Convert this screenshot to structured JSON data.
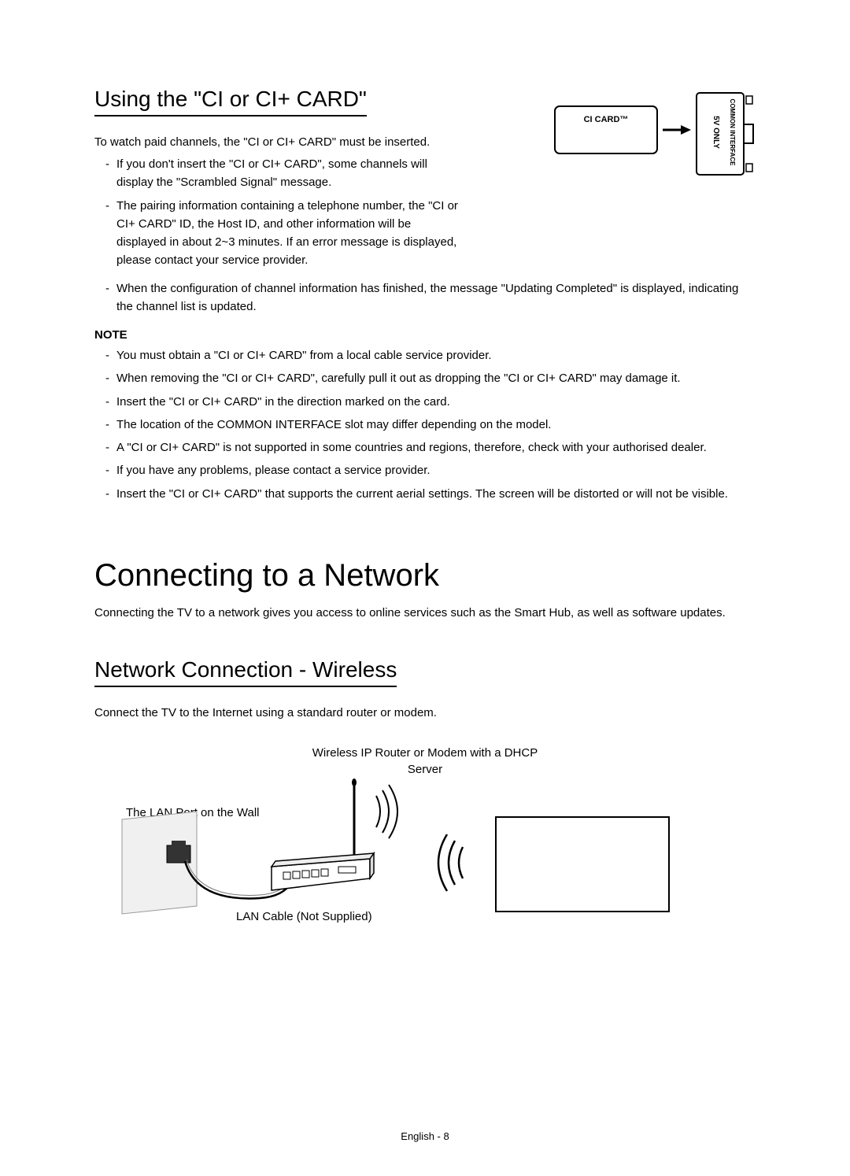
{
  "section1": {
    "heading": "Using the \"CI or CI+ CARD\"",
    "intro": "To watch paid channels, the \"CI or CI+ CARD\" must be inserted.",
    "bullets": [
      "If you don't insert the \"CI or CI+ CARD\", some channels will display the \"Scrambled Signal\" message.",
      "The pairing information containing a telephone number, the \"CI or CI+ CARD\" ID, the Host ID, and other information will be displayed in about 2~3 minutes. If an error message is displayed, please contact your service provider.",
      "When the configuration of channel information has finished, the message \"Updating Completed\" is displayed, indicating the channel list is updated."
    ],
    "note_label": "NOTE",
    "notes": [
      "You must obtain a \"CI or CI+ CARD\" from a local cable service provider.",
      "When removing the \"CI or CI+ CARD\", carefully pull it out as dropping the \"CI or CI+ CARD\" may damage it.",
      "Insert the \"CI or CI+ CARD\" in the direction marked on the card.",
      "The location of the COMMON INTERFACE slot may differ depending on the model.",
      "A \"CI or CI+ CARD\" is not supported in some countries and regions, therefore, check with your authorised dealer.",
      "If you have any problems, please contact a service provider.",
      "Insert the \"CI or CI+ CARD\" that supports the current aerial settings. The screen will be distorted or will not be visible."
    ]
  },
  "diagram_ci": {
    "card_label": "CI CARD™",
    "slot_label_line1": "5V ONLY",
    "slot_label_line2": "COMMON INTERFACE"
  },
  "section2": {
    "heading": "Connecting to a Network",
    "intro": "Connecting the TV to a network gives you access to online services such as the Smart Hub, as well as software updates."
  },
  "section3": {
    "heading": "Network Connection - Wireless",
    "intro": "Connect the TV to the Internet using a standard router or modem.",
    "router_caption": "Wireless IP Router or Modem with a DHCP Server",
    "wall_port_label": "The LAN Port on the Wall",
    "lan_cable_label": "LAN Cable (Not Supplied)"
  },
  "footer": "English - 8"
}
